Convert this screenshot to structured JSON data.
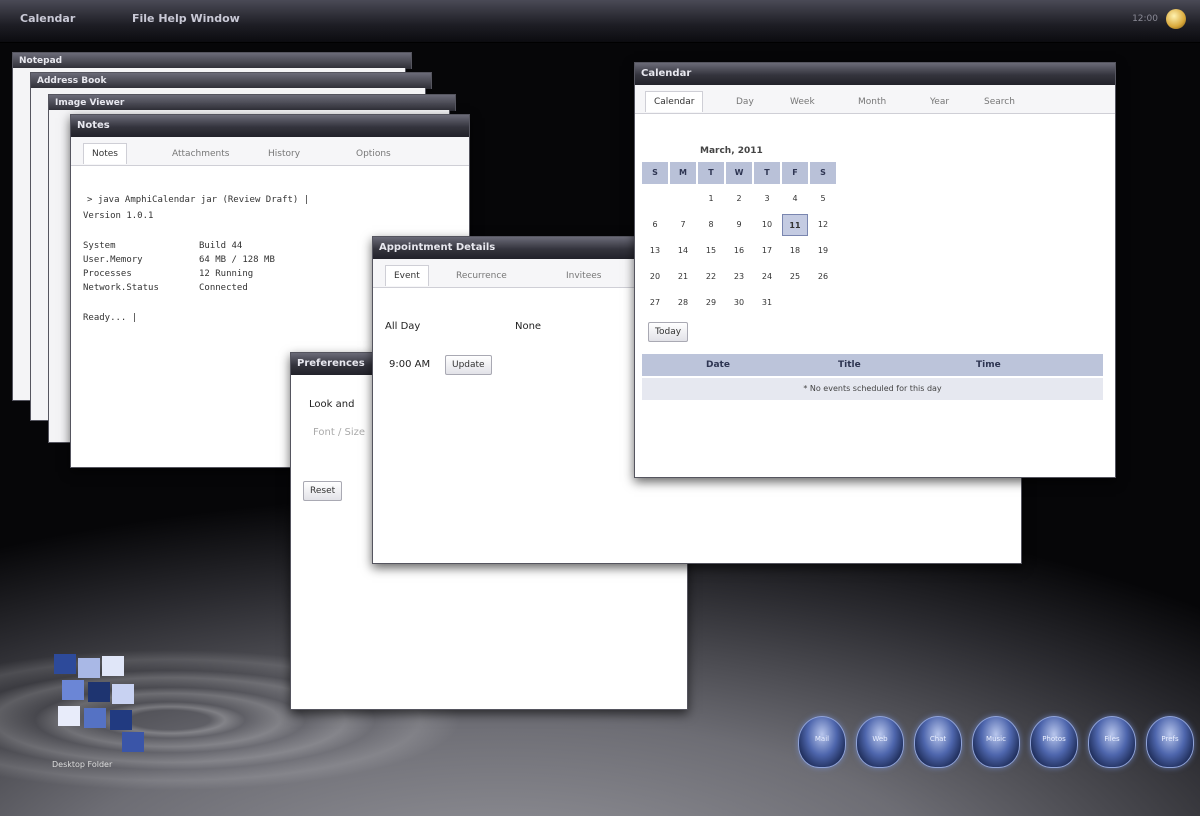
{
  "topbar": {
    "menu_1": "Calendar",
    "menu_2": "File   Help   Window",
    "tray_text": "12:00"
  },
  "stack": {
    "w1": "Notepad",
    "w2": "Address Book",
    "w3": "Image Viewer"
  },
  "notes_window": {
    "title": "Notes",
    "tabs": [
      "Notes",
      "Attachments",
      "History",
      "Options"
    ],
    "header_line_1": "> java AmphiCalendar jar (Review Draft) |",
    "header_line_2": "Version 1.0.1",
    "rows": [
      {
        "label": "System",
        "value": "Build 44"
      },
      {
        "label": "User.Memory",
        "value": "64 MB / 128 MB"
      },
      {
        "label": "Processes",
        "value": "12 Running"
      },
      {
        "label": "Network.Status",
        "value": "Connected"
      }
    ],
    "footer": "Ready... |"
  },
  "small_window": {
    "title": "Preferences",
    "line_1": "Look and",
    "line_2": "Font / Size",
    "button": "Reset"
  },
  "middle_window": {
    "title": "Appointment Details",
    "tabs": [
      "Event",
      "Recurrence",
      "Invitees"
    ],
    "field_label": "All Day",
    "field_value": "None",
    "time_value": "9:00 AM",
    "button": "Update"
  },
  "calendar_window": {
    "title": "Calendar",
    "tabs": [
      "Calendar",
      "Day",
      "Week",
      "Month",
      "Year",
      "Search"
    ],
    "month_label": "March, 2011",
    "day_headers": [
      "S",
      "M",
      "T",
      "W",
      "T",
      "F",
      "S"
    ],
    "weeks": [
      [
        "",
        "",
        "1",
        "2",
        "3",
        "4",
        "5"
      ],
      [
        "6",
        "7",
        "8",
        "9",
        "10",
        "11",
        "12"
      ],
      [
        "13",
        "14",
        "15",
        "16",
        "17",
        "18",
        "19"
      ],
      [
        "20",
        "21",
        "22",
        "23",
        "24",
        "25",
        "26"
      ],
      [
        "27",
        "28",
        "29",
        "30",
        "31",
        "",
        ""
      ]
    ],
    "today": "11",
    "today_button": "Today",
    "event_columns": [
      "Date",
      "Title",
      "Time"
    ],
    "event_empty": "* No events scheduled for this day"
  },
  "dock": {
    "items": [
      "Mail",
      "Web",
      "Chat",
      "Music",
      "Photos",
      "Files",
      "Prefs"
    ]
  },
  "desktop": {
    "icon_label": "Desktop Folder"
  },
  "colors": {
    "titlebar": "#34343d",
    "accent": "#4e66ad",
    "calendar_header": "#b9c1d8"
  }
}
